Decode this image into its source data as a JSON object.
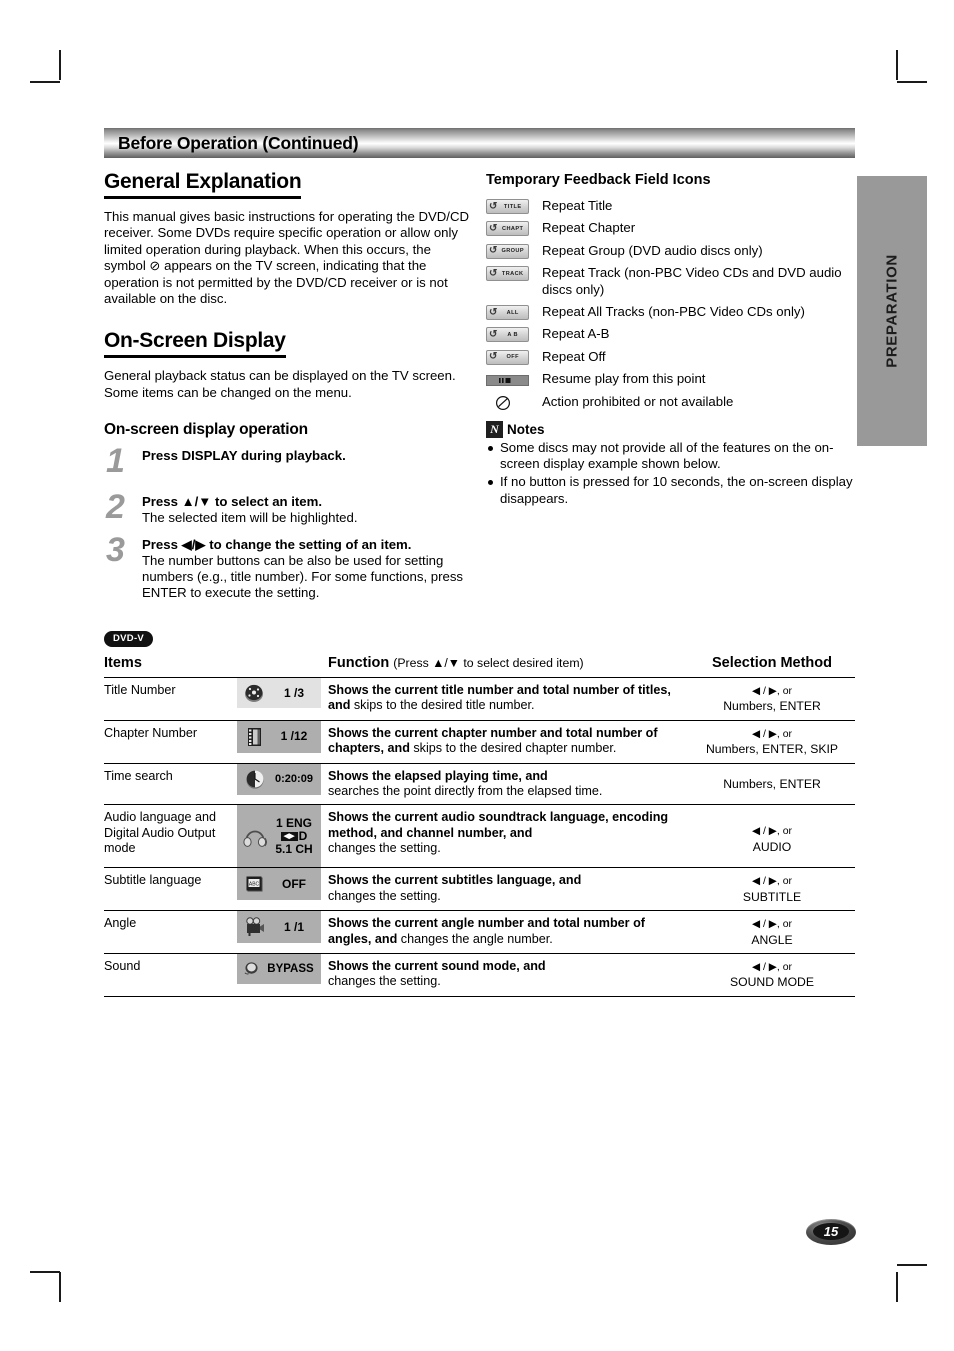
{
  "header": {
    "title": "Before Operation (Continued)"
  },
  "sidebar_tab": {
    "label": "PREPARATION"
  },
  "left": {
    "general_explanation": {
      "heading": "General Explanation",
      "paragraph": "This manual gives basic instructions for operating the DVD/CD receiver. Some DVDs require specific operation or allow only limited operation during playback. When this occurs, the symbol ⊘ appears on the TV screen, indicating that the operation is not permitted by the DVD/CD receiver or is not available on the disc."
    },
    "on_screen_display": {
      "heading": "On-Screen Display",
      "paragraph": "General playback status can be displayed on the TV screen. Some items can be changed on the menu."
    },
    "operation": {
      "heading": "On-screen display operation",
      "steps": [
        {
          "num": "1",
          "title": "Press DISPLAY during playback.",
          "detail": ""
        },
        {
          "num": "2",
          "title": "Press ▲/▼ to select an item.",
          "detail": "The selected item will be highlighted."
        },
        {
          "num": "3",
          "title": "Press ◀/▶ to change the setting of an item.",
          "detail": "The number buttons can be also be used for setting numbers (e.g., title number). For some functions, press ENTER to execute the setting."
        }
      ]
    }
  },
  "right": {
    "title": "Temporary Feedback Field Icons",
    "icons": [
      {
        "badge": "TITLE",
        "type": "repeat",
        "text": "Repeat Title"
      },
      {
        "badge": "CHAPT",
        "type": "repeat",
        "text": "Repeat Chapter"
      },
      {
        "badge": "GROUP",
        "type": "repeat",
        "text": "Repeat Group (DVD audio discs only)"
      },
      {
        "badge": "TRACK",
        "type": "repeat",
        "text": "Repeat Track (non-PBC Video CDs and DVD audio discs only)"
      },
      {
        "badge": "ALL",
        "type": "repeat",
        "text": "Repeat All Tracks (non-PBC Video CDs only)"
      },
      {
        "badge": "A B",
        "type": "repeat",
        "text": "Repeat A-B"
      },
      {
        "badge": "OFF",
        "type": "repeat",
        "text": "Repeat Off"
      },
      {
        "badge": "",
        "type": "resume",
        "text": "Resume play from this point"
      },
      {
        "badge": "",
        "type": "prohibit",
        "text": "Action prohibited or not available"
      }
    ],
    "notes": {
      "label": "Notes",
      "badge": "N",
      "items": [
        "Some discs may not provide all of the features on the on-screen display example shown below.",
        "If no button is pressed for 10 seconds, the on-screen display disappears."
      ]
    }
  },
  "table_section": {
    "disc_badge": "DVD-V",
    "headers": {
      "items": "Items",
      "function": "Function",
      "function_note": "(Press ▲/▼ to select desired item)",
      "selection": "Selection Method"
    },
    "rows": [
      {
        "item": "Title Number",
        "chip": {
          "glyph": "disc-icon",
          "value": "1 /3",
          "shade": "light"
        },
        "function_bold": "Shows the current title number and total number of titles, and",
        "function_rest": " skips to the desired title number.",
        "selection_arrows": "◀ / ▶, or",
        "selection_rest": "Numbers, ENTER"
      },
      {
        "item": "Chapter Number",
        "chip": {
          "glyph": "film-icon",
          "value": "1 /12",
          "shade": "dark"
        },
        "function_bold": "Shows the current chapter number and total number of chapters, and",
        "function_rest": " skips to the desired chapter number.",
        "selection_arrows": "◀ / ▶, or",
        "selection_rest": "Numbers, ENTER, SKIP"
      },
      {
        "item": "Time search",
        "chip": {
          "glyph": "clock-icon",
          "value": "0:20:09",
          "shade": "dark"
        },
        "function_bold": "Shows the elapsed playing time, and",
        "function_rest": "searches the point directly from the elapsed time.",
        "selection_arrows": "",
        "selection_rest": "Numbers, ENTER"
      },
      {
        "item": "Audio language and Digital Audio Output mode",
        "chip": {
          "glyph": "headphone-icon",
          "value": "1 ENG",
          "value2": "D",
          "value3": "5.1 CH",
          "shade": "dark"
        },
        "function_bold": "Shows the current audio soundtrack language, encoding method, and channel number, and",
        "function_rest": "changes the setting.",
        "selection_arrows": "◀ / ▶, or",
        "selection_rest": "AUDIO"
      },
      {
        "item": "Subtitle language",
        "chip": {
          "glyph": "subtitle-icon",
          "value": "OFF",
          "shade": "dark"
        },
        "function_bold": "Shows the current subtitles language, and",
        "function_rest": "changes the setting.",
        "selection_arrows": "◀ / ▶, or",
        "selection_rest": "SUBTITLE"
      },
      {
        "item": "Angle",
        "chip": {
          "glyph": "camera-icon",
          "value": "1 /1",
          "shade": "dark"
        },
        "function_bold": "Shows the current angle number and total number of angles, and",
        "function_rest": " changes the angle number.",
        "selection_arrows": "◀ / ▶, or",
        "selection_rest": "ANGLE"
      },
      {
        "item": "Sound",
        "chip": {
          "glyph": "speaker-icon",
          "value": "BYPASS",
          "shade": "dark"
        },
        "function_bold": "Shows the current sound mode, and",
        "function_rest": "changes the setting.",
        "selection_arrows": "◀ / ▶, or",
        "selection_rest": "SOUND MODE"
      }
    ]
  },
  "page_number": "15"
}
